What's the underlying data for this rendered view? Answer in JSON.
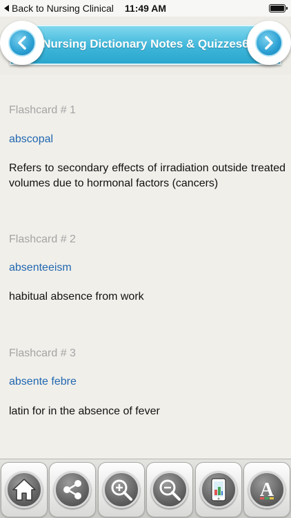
{
  "status_bar": {
    "back_label": "Back to Nursing Clinical",
    "time": "11:49 AM"
  },
  "header": {
    "title": "Nursing Dictionary Notes & Quizzes6",
    "accent_color": "#3fb6da"
  },
  "flashcards": [
    {
      "number_label": "Flashcard # 1",
      "term": "abscopal",
      "definition": "Refers to secondary effects of irradiation outside treated volumes due to hormonal factors (cancers)"
    },
    {
      "number_label": "Flashcard # 2",
      "term": "absenteeism",
      "definition": "habitual absence from work"
    },
    {
      "number_label": "Flashcard # 3",
      "term": "absente febre",
      "definition": "latin for in the absence of fever"
    }
  ],
  "toolbar": {
    "buttons": [
      "home-icon",
      "share-icon",
      "zoom-in-icon",
      "zoom-out-icon",
      "tablet-icon",
      "font-icon"
    ]
  }
}
